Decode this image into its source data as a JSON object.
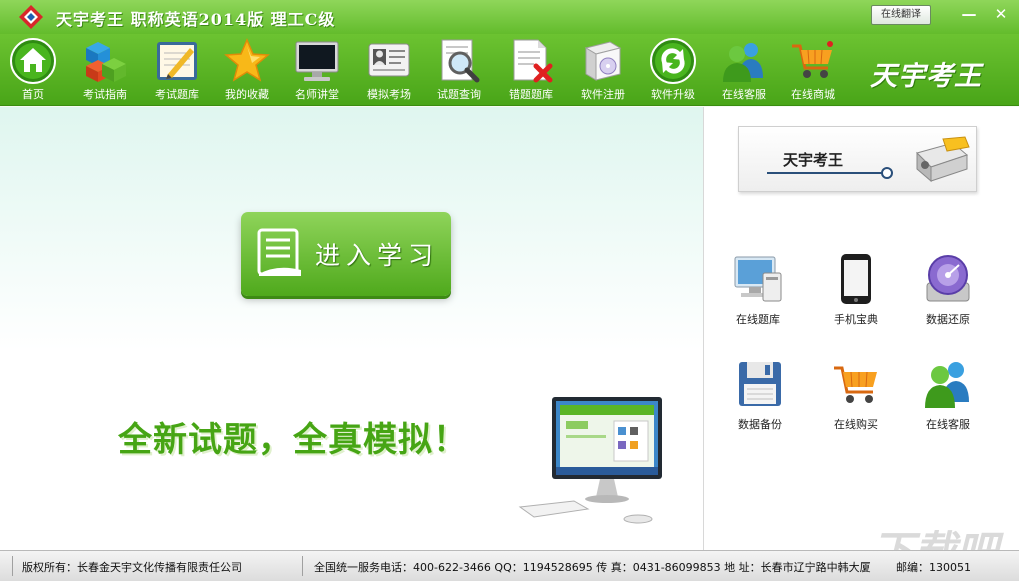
{
  "window": {
    "title": "天宇考王  职称英语2014版  理工C级",
    "translate_button": "在线翻译",
    "minimize_glyph": "—",
    "close_glyph": "✕"
  },
  "toolbar": {
    "items": [
      {
        "label": "首页",
        "icon": "home-icon"
      },
      {
        "label": "考试指南",
        "icon": "cubes-icon"
      },
      {
        "label": "考试题库",
        "icon": "notepad-pencil-icon"
      },
      {
        "label": "我的收藏",
        "icon": "star-icon"
      },
      {
        "label": "名师讲堂",
        "icon": "monitor-icon"
      },
      {
        "label": "模拟考场",
        "icon": "id-card-icon"
      },
      {
        "label": "试题查询",
        "icon": "magnifier-document-icon"
      },
      {
        "label": "错题题库",
        "icon": "document-error-icon"
      },
      {
        "label": "软件注册",
        "icon": "software-box-icon"
      },
      {
        "label": "软件升级",
        "icon": "upgrade-arrows-icon"
      },
      {
        "label": "在线客服",
        "icon": "users-icon"
      },
      {
        "label": "在线商城",
        "icon": "shopping-cart-icon"
      }
    ],
    "brand": "天宇考王"
  },
  "main": {
    "study_button": "进入学习",
    "slogan": "全新试题，全真模拟！"
  },
  "sidebar": {
    "brand_card_title": "天宇考王",
    "items": [
      {
        "label": "在线题库",
        "icon": "monitor-computer-icon"
      },
      {
        "label": "手机宝典",
        "icon": "smartphone-icon"
      },
      {
        "label": "数据还原",
        "icon": "disk-restore-icon"
      },
      {
        "label": "数据备份",
        "icon": "floppy-disk-icon"
      },
      {
        "label": "在线购买",
        "icon": "shopping-cart-icon"
      },
      {
        "label": "在线客服",
        "icon": "users-icon"
      }
    ]
  },
  "statusbar": {
    "copyright": "版权所有：长春金天宇文化传播有限责任公司",
    "contact": "全国统一服务电话：400-622-3466 QQ：1194528695  传 真：0431-86099853 地 址：长春市辽宁路中韩大厦",
    "postcode": "邮编：130051"
  },
  "watermark": "下载吧",
  "colors": {
    "toolbar_green": "#5ab526",
    "slogan_green": "#46a514",
    "button_green": "#6cc33a"
  }
}
